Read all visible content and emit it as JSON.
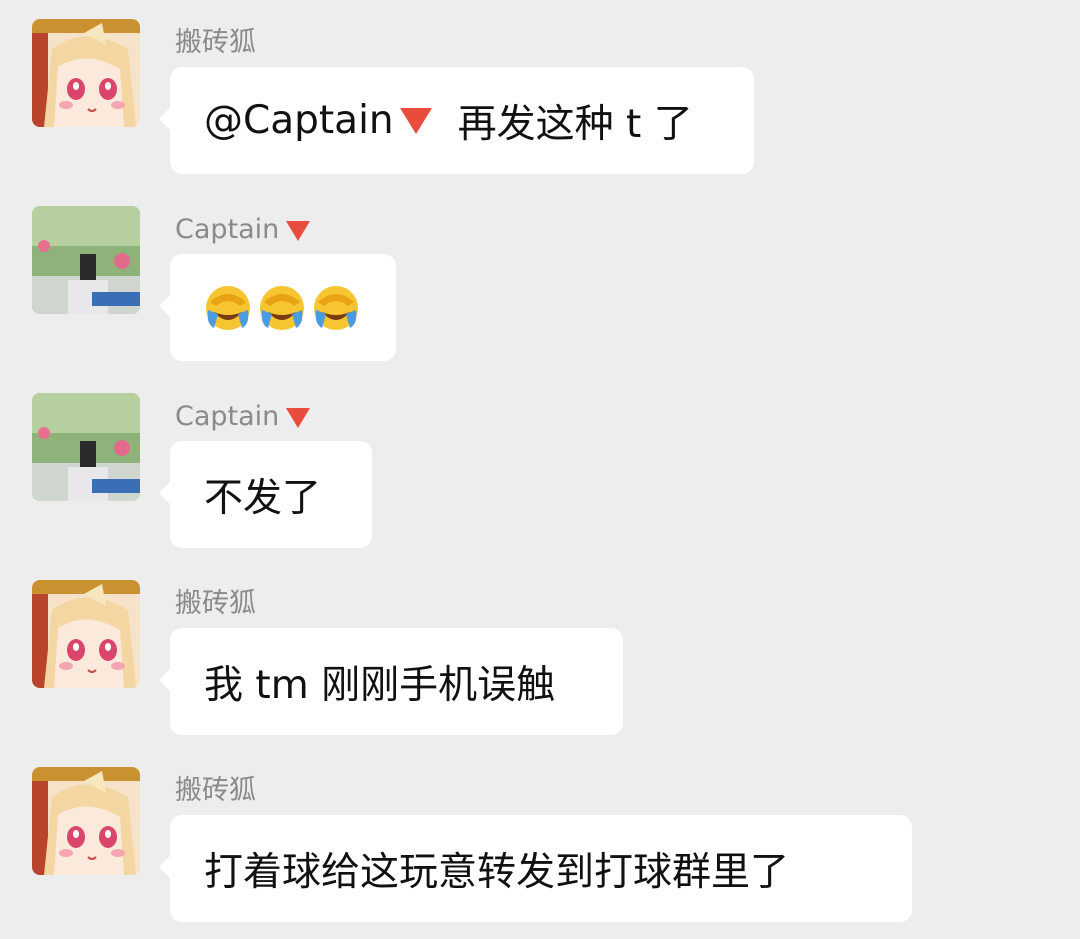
{
  "messages": [
    {
      "sender": "搬砖狐",
      "avatar": "anime-fox-girl-avatar",
      "mention": "@Captain",
      "text": "再发这种 t 了"
    },
    {
      "sender": "Captain",
      "avatar": "photo-avatar",
      "emoji": [
        "face-with-tears-of-joy-facepalm-emoji",
        "face-with-tears-of-joy-facepalm-emoji",
        "face-with-tears-of-joy-facepalm-emoji"
      ]
    },
    {
      "sender": "Captain",
      "avatar": "photo-avatar",
      "text": "不发了"
    },
    {
      "sender": "搬砖狐",
      "avatar": "anime-fox-girl-avatar",
      "text": "我 tm 刚刚手机误触"
    },
    {
      "sender": "搬砖狐",
      "avatar": "anime-fox-girl-avatar",
      "text": "打着球给这玩意转发到打球群里了"
    }
  ],
  "colors": {
    "background": "#ededed",
    "bubble": "#ffffff",
    "sender_name": "#8a8a8a",
    "red_triangle": "#e74c3c"
  }
}
